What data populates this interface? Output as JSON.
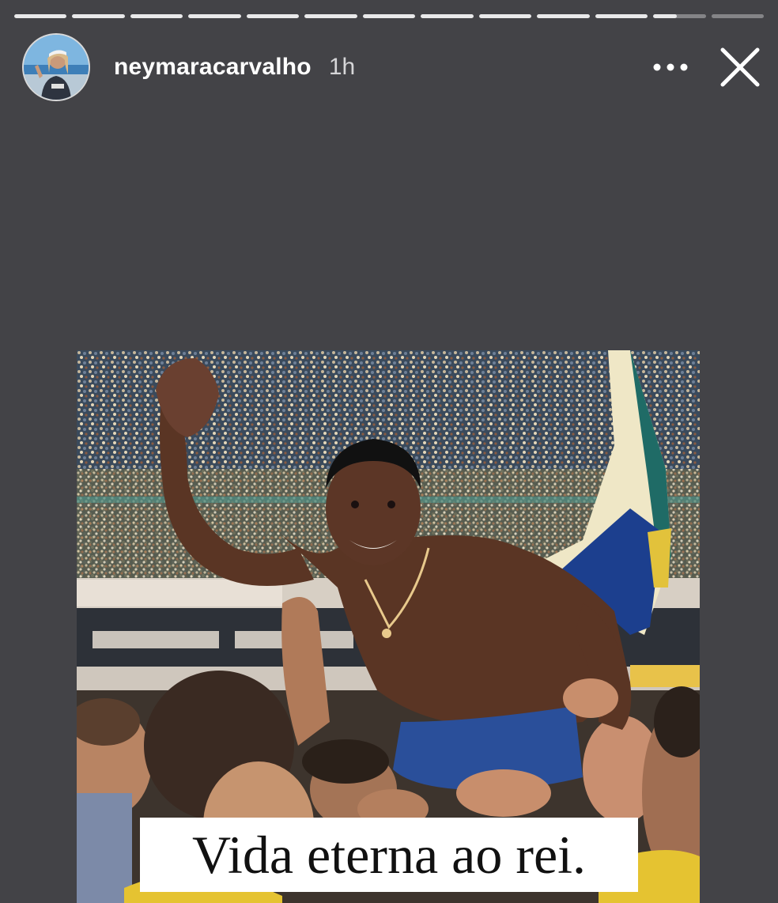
{
  "story": {
    "segments": [
      {
        "progress": 1
      },
      {
        "progress": 1
      },
      {
        "progress": 1
      },
      {
        "progress": 1
      },
      {
        "progress": 1
      },
      {
        "progress": 1
      },
      {
        "progress": 1
      },
      {
        "progress": 1
      },
      {
        "progress": 1
      },
      {
        "progress": 1
      },
      {
        "progress": 1
      },
      {
        "progress": 0.45
      },
      {
        "progress": 0
      }
    ],
    "username": "neymaracarvalho",
    "time_ago": "1h",
    "more_icon": "more-horizontal-icon",
    "close_icon": "close-icon"
  },
  "post": {
    "caption": "Vida eterna ao rei."
  },
  "colors": {
    "background": "#434347",
    "progress_fill": "#e9e9ea",
    "progress_track": "rgba(255,255,255,0.35)"
  }
}
